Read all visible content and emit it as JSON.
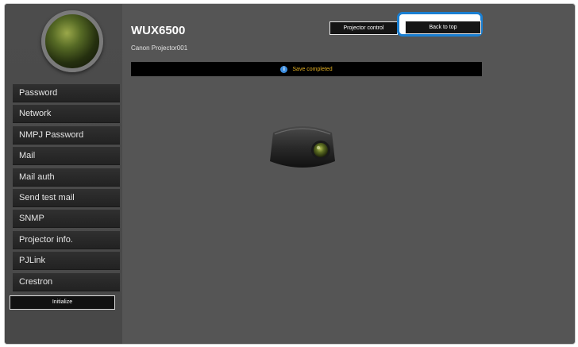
{
  "header": {
    "title": "WUX6500",
    "subtitle": "Canon Projector001",
    "projector_control_label": "Projector control",
    "back_to_top_label": "Back to top"
  },
  "status": {
    "icon": "info-icon",
    "message": "Save completed"
  },
  "sidebar": {
    "items": [
      {
        "label": "Password"
      },
      {
        "label": "Network"
      },
      {
        "label": "NMPJ Password"
      },
      {
        "label": "Mail"
      },
      {
        "label": "Mail auth"
      },
      {
        "label": "Send test mail"
      },
      {
        "label": "SNMP"
      },
      {
        "label": "Projector info."
      },
      {
        "label": "PJLink"
      },
      {
        "label": "Crestron"
      }
    ],
    "initialize_label": "Initialize"
  },
  "colors": {
    "background": "#555555",
    "highlight": "#1a7fd2",
    "status_text": "#e3b023"
  }
}
